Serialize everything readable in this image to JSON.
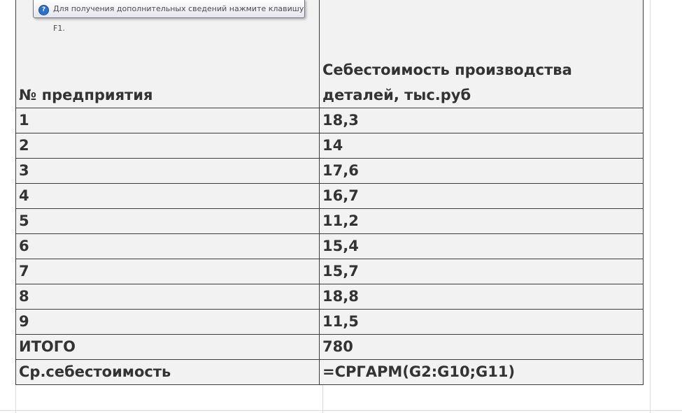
{
  "tooltip": {
    "icon": "help-icon",
    "text": "Для получения дополнительных сведений нажмите клавишу F1."
  },
  "table": {
    "headers": {
      "col1": "№ предприятия",
      "col2": "Себестоимость производства деталей, тыс.руб"
    },
    "rows": [
      {
        "a": "1",
        "b": "18,3"
      },
      {
        "a": "2",
        "b": "14"
      },
      {
        "a": "3",
        "b": "17,6"
      },
      {
        "a": "4",
        "b": "16,7"
      },
      {
        "a": "5",
        "b": "11,2"
      },
      {
        "a": "6",
        "b": "15,4"
      },
      {
        "a": "7",
        "b": "15,7"
      },
      {
        "a": "8",
        "b": "18,8"
      },
      {
        "a": "9",
        "b": "11,5"
      },
      {
        "a": "ИТОГО",
        "b": "780"
      },
      {
        "a": "Ср.себестоимость",
        "b": "=СРГАРМ(G2:G10;G11)"
      }
    ]
  },
  "colors": {
    "cell_fill": "#f2f2f2",
    "cell_text": "#333333",
    "border": "#3c3c3c",
    "gridline": "#dadcdd"
  }
}
